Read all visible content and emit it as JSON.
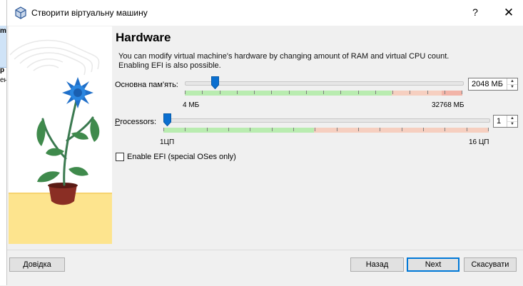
{
  "window": {
    "title": "Створити віртуальну машину",
    "help_label": "?",
    "close_label": "✕"
  },
  "background_app": {
    "glyphs": [
      "m",
      "р",
      "ен"
    ]
  },
  "page": {
    "heading": "Hardware",
    "description_line1": "You can modify virtual machine's hardware by changing amount of RAM and virtual CPU count.",
    "description_line2": "Enabling EFI is also possible."
  },
  "memory": {
    "label": "Основна пам'ять:",
    "value": "2048 МБ",
    "min_label": "4 МБ",
    "max_label": "32768 МБ",
    "min": 4,
    "max": 32768,
    "current": 2048
  },
  "processors": {
    "label": "Processors:",
    "value": "1",
    "min_label": "1ЦП",
    "max_label": "16 ЦП",
    "min": 1,
    "max": 16,
    "current": 1
  },
  "efi": {
    "label": "Enable EFI (special OSes only)",
    "checked": false
  },
  "footer": {
    "help_button": "Довідка",
    "back_button": "Назад",
    "next_button": "Next",
    "cancel_button": "Скасувати"
  },
  "colors": {
    "slider_handle": "#0a6fd0",
    "scale_ok": "#b9ecb0",
    "scale_warn": "#f6cfc0",
    "scale_bad": "#f2b4a8",
    "default_button_border": "#0078d7"
  },
  "icons": [
    "virtualbox-icon",
    "help-icon",
    "close-icon",
    "flower-pot-illustration"
  ]
}
